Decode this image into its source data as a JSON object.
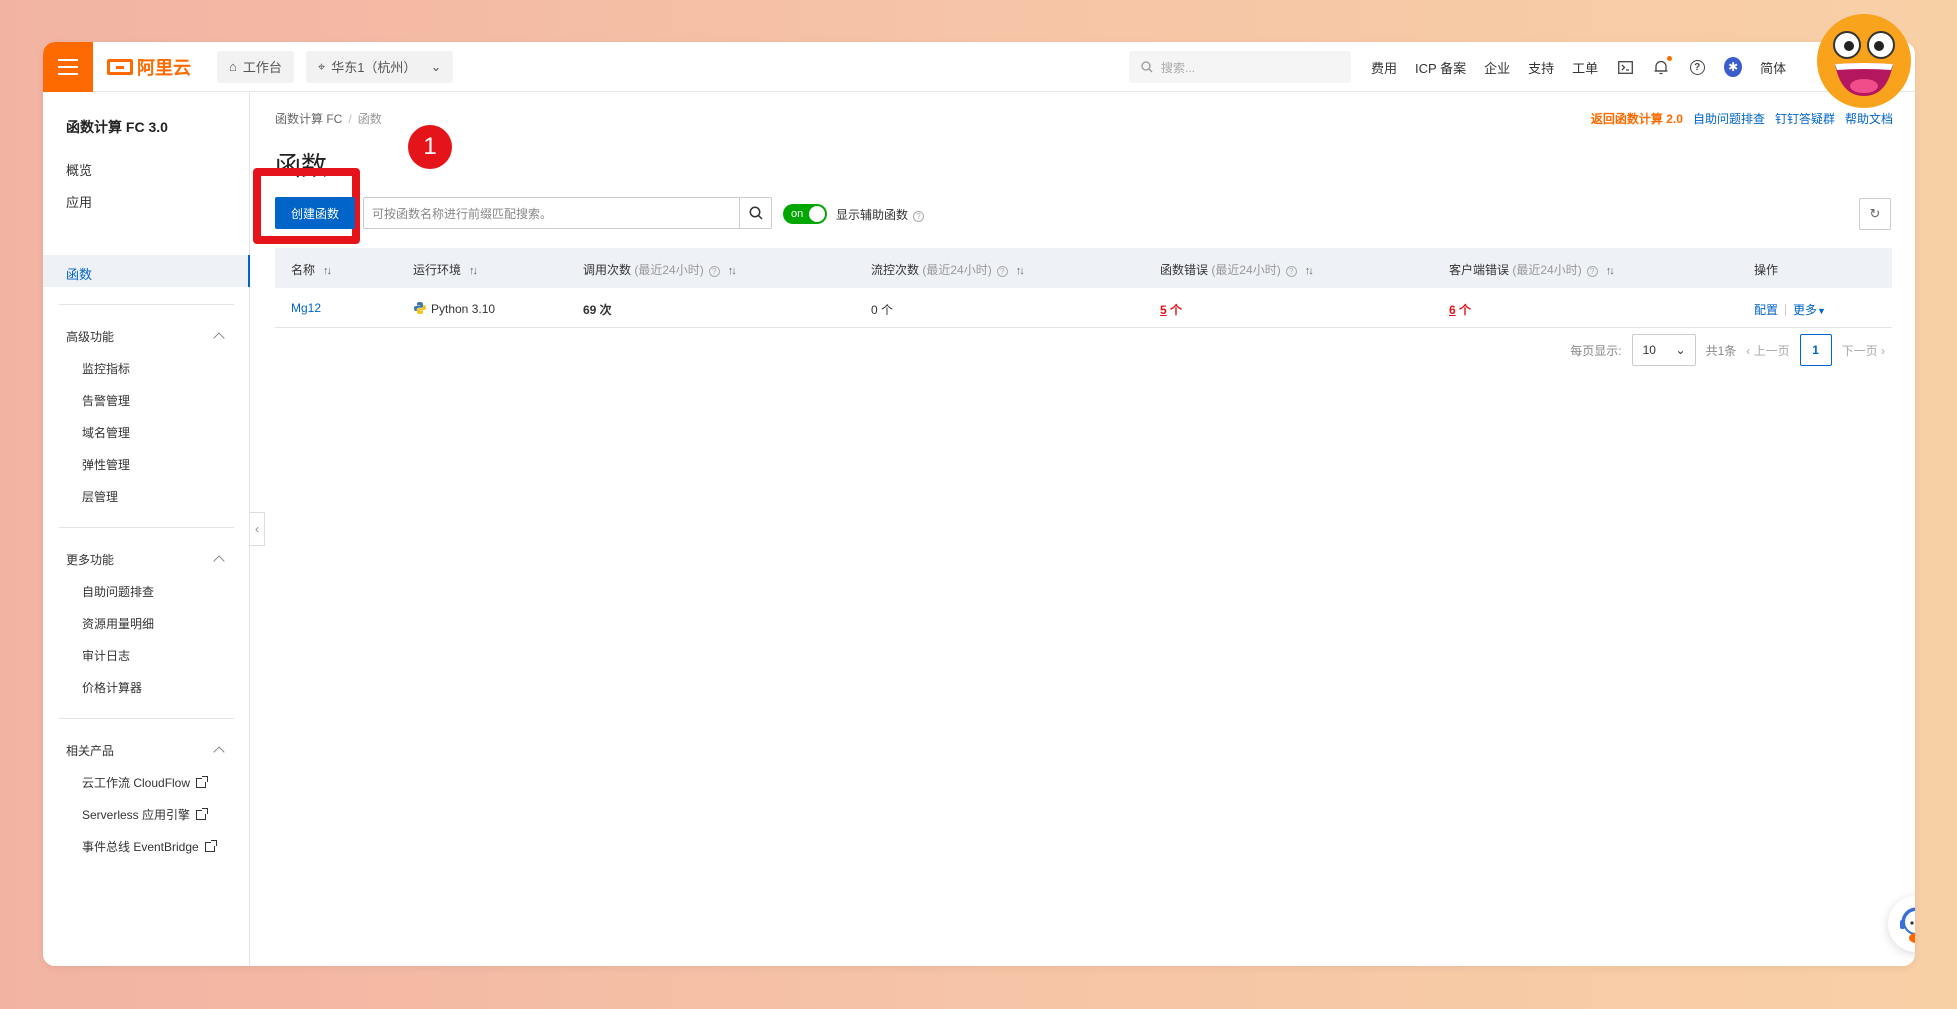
{
  "topbar": {
    "brand": "阿里云",
    "workbench": "工作台",
    "region": "华东1（杭州）",
    "search_placeholder": "搜索...",
    "links": [
      "费用",
      "ICP 备案",
      "企业",
      "支持",
      "工单"
    ],
    "lang": "简体"
  },
  "sidebar": {
    "title": "函数计算 FC 3.0",
    "items": [
      "概览",
      "应用",
      "函数"
    ],
    "active": "函数",
    "group_advanced": "高级功能",
    "advanced_items": [
      "监控指标",
      "告警管理",
      "域名管理",
      "弹性管理",
      "层管理"
    ],
    "group_more": "更多功能",
    "more_items": [
      "自助问题排查",
      "资源用量明细",
      "审计日志",
      "价格计算器"
    ],
    "group_related": "相关产品",
    "related_items": [
      "云工作流 CloudFlow",
      "Serverless 应用引擎",
      "事件总线 EventBridge"
    ]
  },
  "breadcrumb": {
    "root": "函数计算 FC",
    "current": "函数"
  },
  "header_links": {
    "back": "返回函数计算 2.0",
    "troubleshoot": "自助问题排查",
    "dingtalk": "钉钉答疑群",
    "docs": "帮助文档"
  },
  "page": {
    "title": "函数",
    "step": "1",
    "create_button": "创建函数",
    "search_placeholder": "可按函数名称进行前缀匹配搜索。",
    "toggle_state": "on",
    "toggle_label": "显示辅助函数"
  },
  "table": {
    "columns": [
      {
        "label": "名称",
        "note": ""
      },
      {
        "label": "运行环境",
        "note": ""
      },
      {
        "label": "调用次数",
        "note": "(最近24小时)"
      },
      {
        "label": "流控次数",
        "note": "(最近24小时)"
      },
      {
        "label": "函数错误",
        "note": "(最近24小时)"
      },
      {
        "label": "客户端错误",
        "note": "(最近24小时)"
      },
      {
        "label": "操作",
        "note": ""
      }
    ],
    "rows": [
      {
        "name": "Mg12",
        "runtime": "Python 3.10",
        "invocations": "69 次",
        "throttles": "0 个",
        "func_errors_num": "5",
        "func_errors_unit": " 个",
        "client_errors_num": "6",
        "client_errors_unit": " 个",
        "action_config": "配置",
        "action_more": "更多"
      }
    ]
  },
  "pager": {
    "per_page_label": "每页显示:",
    "per_page": "10",
    "total": "共1条",
    "prev": "上一页",
    "page": "1",
    "next": "下一页"
  },
  "colors": {
    "accent": "#0064c8",
    "brand": "#ff6a00",
    "highlight": "#e5141a",
    "toggle": "#00a700"
  }
}
